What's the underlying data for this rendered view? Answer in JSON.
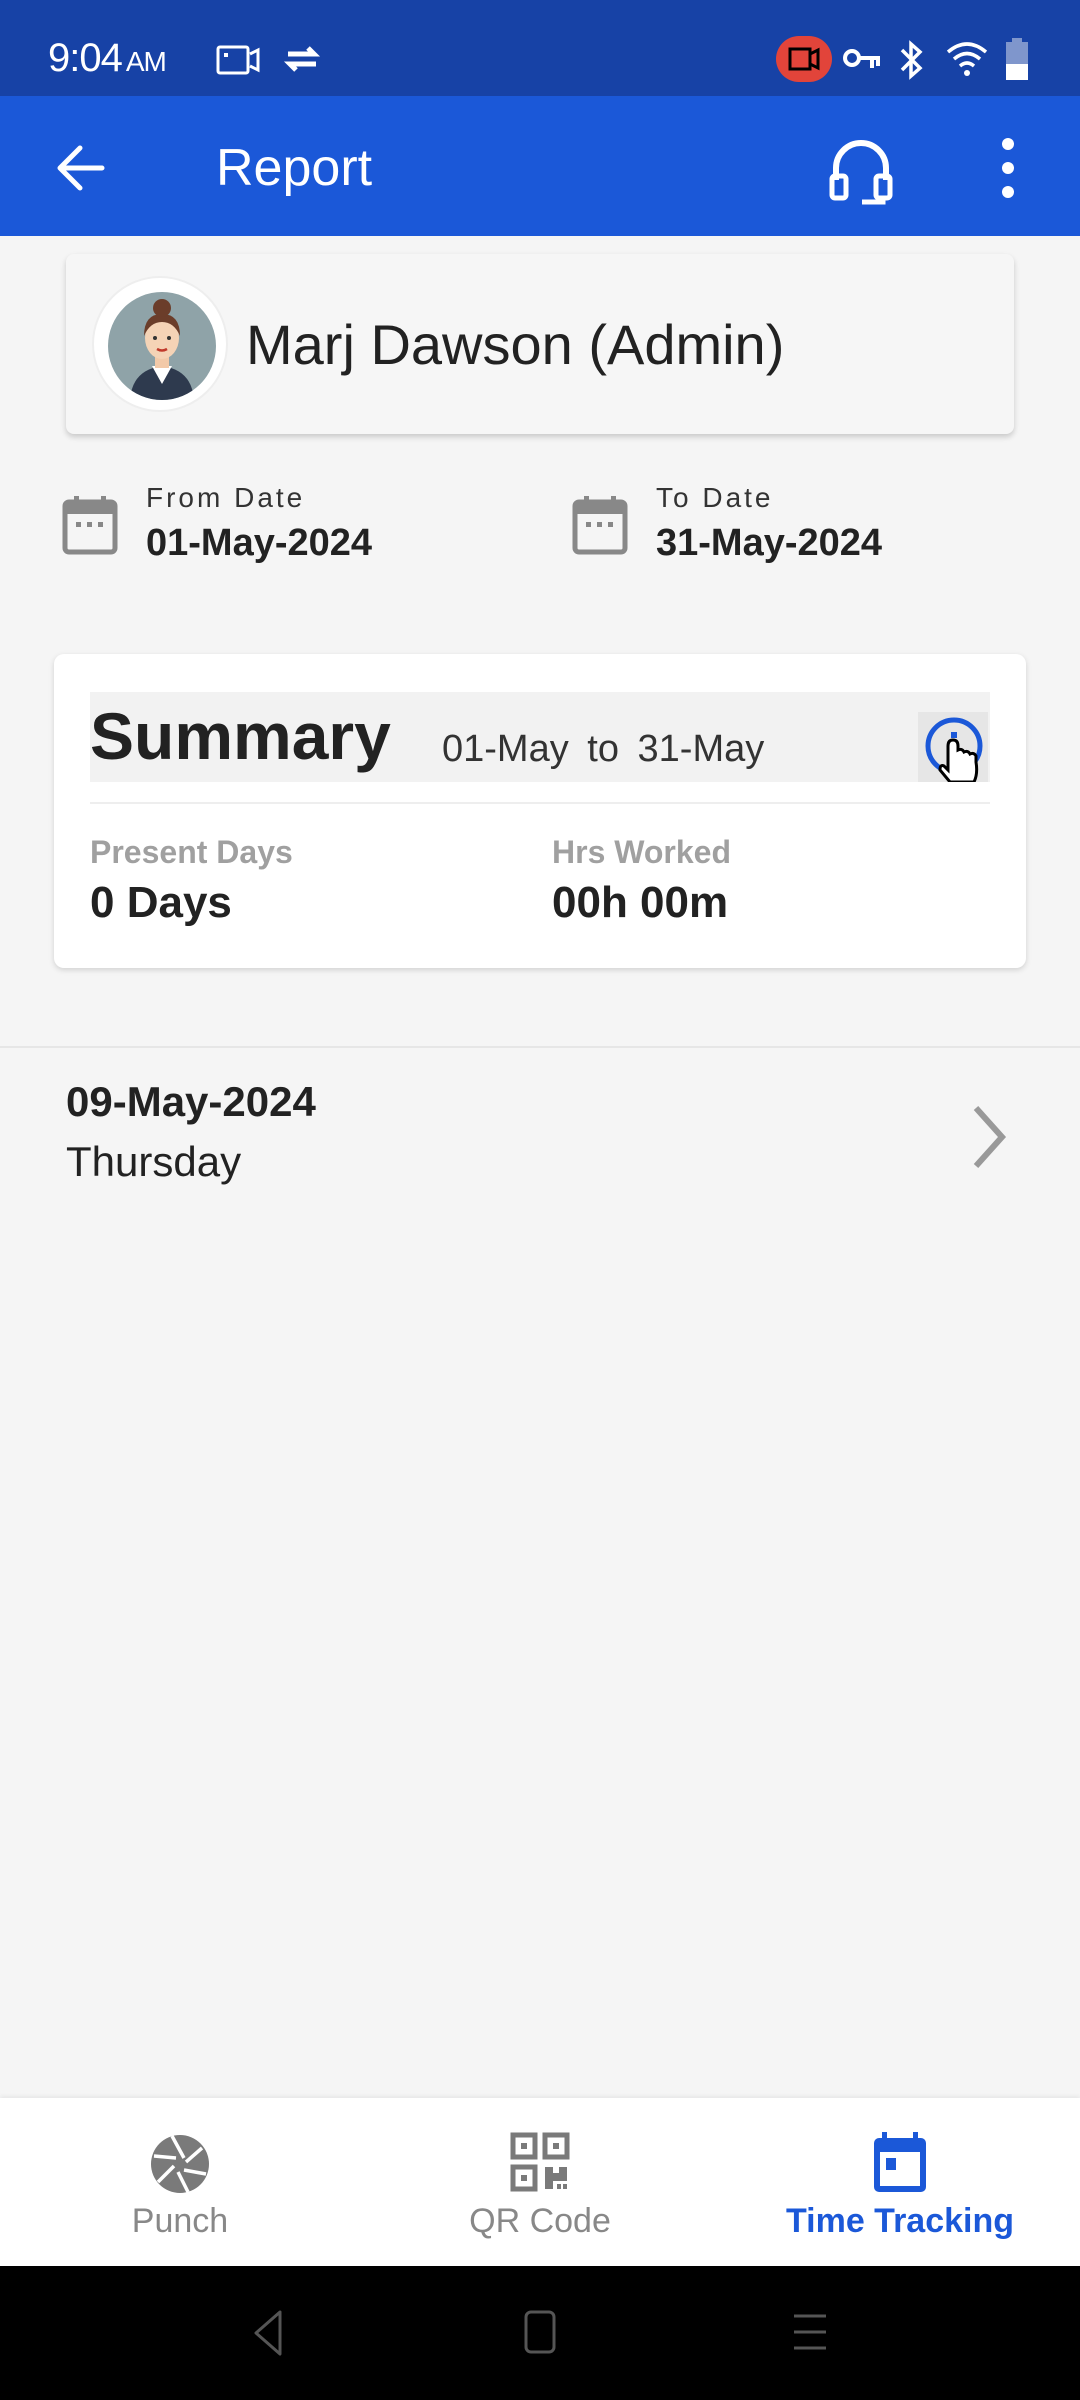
{
  "status_bar": {
    "time": "9:04",
    "ampm": "AM",
    "icons": [
      "screen-record-icon",
      "sync-icon",
      "recording-indicator-icon",
      "vpn-key-icon",
      "bluetooth-icon",
      "wifi-icon",
      "battery-icon"
    ]
  },
  "app_bar": {
    "title": "Report",
    "back_icon": "arrow-left-icon",
    "support_icon": "headset-icon",
    "menu_icon": "more-vertical-icon"
  },
  "profile": {
    "name": "Marj Dawson (Admin)",
    "avatar": "user-avatar"
  },
  "date_range": {
    "from_label": "From Date",
    "from_value": "01-May-2024",
    "to_label": "To Date",
    "to_value": "31-May-2024"
  },
  "summary": {
    "title": "Summary",
    "range": "01-May  to  31-May",
    "present_days_label": "Present Days",
    "present_days_value": "0 Days",
    "hrs_worked_label": "Hrs Worked",
    "hrs_worked_value": "00h 00m"
  },
  "days": [
    {
      "date": "09-May-2024",
      "weekday": "Thursday"
    }
  ],
  "bottom_nav": {
    "items": [
      {
        "label": "Punch",
        "icon": "shutter-icon",
        "active": false
      },
      {
        "label": "QR Code",
        "icon": "qr-code-icon",
        "active": false
      },
      {
        "label": "Time Tracking",
        "icon": "calendar-icon",
        "active": true
      }
    ]
  },
  "colors": {
    "status_bar": "#1742a6",
    "primary": "#1b58d8",
    "background": "#f5f5f5",
    "inactive": "#888888"
  }
}
